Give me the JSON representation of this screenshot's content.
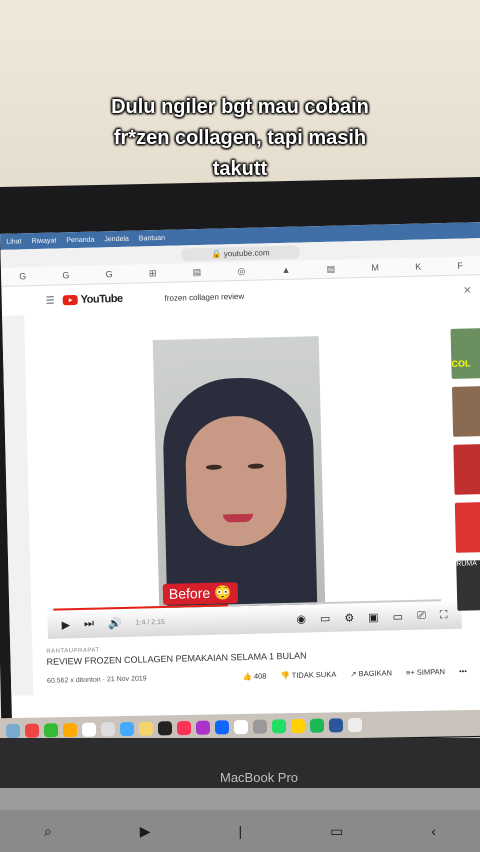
{
  "caption": {
    "line1": "Dulu ngiler bgt mau cobain",
    "line2": "fr*zen collagen, tapi masih",
    "line3": "takutt"
  },
  "menubar": [
    "Lihat",
    "Riwayat",
    "Penanda",
    "Jendela",
    "Bantuan"
  ],
  "browser": {
    "url": "youtube.com"
  },
  "bookmarks": [
    "G",
    "G",
    "G",
    "⊞",
    "▤",
    "◎",
    "▲",
    "▤",
    "M",
    "K",
    "F"
  ],
  "youtube": {
    "logo_text": "YouTube",
    "search_value": "frozen collagen review",
    "player": {
      "before_label": "Before",
      "time": "1:4 / 2:15",
      "progress": 0.45
    },
    "video": {
      "channel": "RANTAUPRAPAT",
      "title": "REVIEW FROZEN COLLAGEN PEMAKAIAN SELAMA 1 BULAN",
      "stats": "60.562 x ditonton · 21 Nov 2019",
      "likes": "408",
      "dislike_label": "TIDAK SUKA",
      "share_label": "BAGIKAN",
      "save_label": "SIMPAN",
      "more": "•••"
    },
    "sidebar_thumbs": [
      "COL",
      "",
      "",
      "",
      "RUMA",
      "DIBALI",
      "",
      "BIRT"
    ]
  },
  "laptop": {
    "brand": "MacBook Pro"
  },
  "colors": {
    "youtube_red": "#e62117",
    "menubar_blue": "#3f6fa6"
  }
}
